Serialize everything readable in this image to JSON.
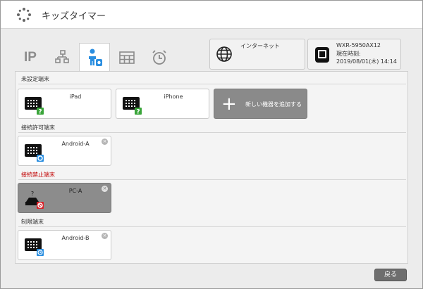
{
  "app": {
    "title": "キッズタイマー"
  },
  "tabs": [
    {
      "label": "IP",
      "icon": "ip-text"
    },
    {
      "icon": "network-devices-icon"
    },
    {
      "icon": "child-device-icon",
      "active": true
    },
    {
      "icon": "calendar-grid-icon"
    },
    {
      "icon": "alarm-clock-icon"
    }
  ],
  "status": {
    "internet_label": "インターネット",
    "router_model": "WXR-5950AX12",
    "time_label": "現在時刻:",
    "time_value": "2019/08/01(木) 14:14"
  },
  "sections": {
    "unconfigured": {
      "label": "未設定端末",
      "devices": [
        {
          "name": "iPad",
          "badge": "?",
          "badge_color": "#3aa53a"
        },
        {
          "name": "iPhone",
          "badge": "?",
          "badge_color": "#3aa53a"
        }
      ],
      "add_label": "新しい機器を追加する"
    },
    "allowed": {
      "label": "接続許可端末",
      "devices": [
        {
          "name": "Android-A",
          "badge": "○",
          "badge_color": "#2a8ee0"
        }
      ]
    },
    "blocked": {
      "label": "接続禁止端末",
      "devices": [
        {
          "name": "PC-A",
          "badge": "⃠",
          "badge_color": "#d9232a"
        }
      ]
    },
    "limited": {
      "label": "制限端末",
      "devices": [
        {
          "name": "Android-B",
          "badge": "◷",
          "badge_color": "#2a8ee0"
        }
      ]
    }
  },
  "footer": {
    "back_label": "戻る"
  },
  "colors": {
    "accent": "#2a8ee0",
    "blocked_red": "#c00000",
    "ok_green": "#3aa53a"
  }
}
